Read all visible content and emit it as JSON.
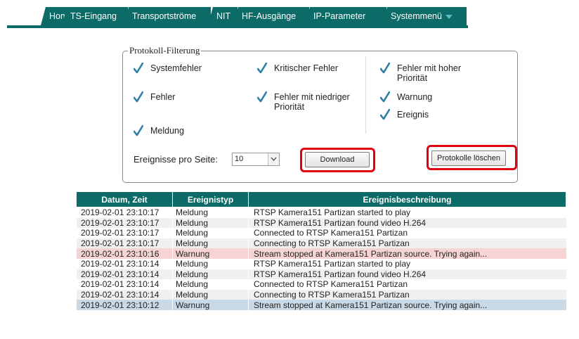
{
  "tabs": [
    {
      "label": "Home"
    },
    {
      "label": "TS-Eingang"
    },
    {
      "label": "Transportströme"
    },
    {
      "label": "NIT"
    },
    {
      "label": "HF-Ausgänge"
    },
    {
      "label": "IP-Parameter"
    },
    {
      "label": "Systemmenü"
    }
  ],
  "filter": {
    "legend": "Protokoll-Filterung",
    "checkboxes": [
      {
        "label": "Systemfehler",
        "checked": true
      },
      {
        "label": "Kritischer Fehler",
        "checked": true
      },
      {
        "label": "Fehler mit hoher\nPriorität",
        "checked": true
      },
      {
        "label": "Fehler",
        "checked": true
      },
      {
        "label": "Fehler mit niedriger\nPriorität",
        "checked": true
      },
      {
        "label": "Warnung",
        "checked": true
      },
      {
        "label": "Ereignis",
        "checked": true
      },
      {
        "label": "Meldung",
        "checked": true
      }
    ],
    "events_per_page_label": "Ereignisse pro Seite:",
    "events_per_page_value": "10",
    "download_label": "Download",
    "clear_label": "Protokolle löschen"
  },
  "colors": {
    "accent": "#0d6b67",
    "highlight": "#e0000f",
    "check": "#2d7fa6",
    "warn_row": "#f7d4d4",
    "selected_row": "#c9d9e5"
  },
  "table": {
    "headers": [
      "Datum, Zeit",
      "Ereignistyp",
      "Ereignisbeschreibung"
    ],
    "rows": [
      {
        "time": "2019-02-01 23:10:17",
        "type": "Meldung",
        "desc": "RTSP Kamera151 Partizan started to play"
      },
      {
        "time": "2019-02-01 23:10:17",
        "type": "Meldung",
        "desc": "RTSP Kamera151 Partizan found video H.264"
      },
      {
        "time": "2019-02-01 23:10:17",
        "type": "Meldung",
        "desc": "Connected to RTSP Kamera151 Partizan"
      },
      {
        "time": "2019-02-01 23:10:17",
        "type": "Meldung",
        "desc": "Connecting to RTSP Kamera151 Partizan"
      },
      {
        "time": "2019-02-01 23:10:16",
        "type": "Warnung",
        "desc": "Stream stopped at Kamera151 Partizan source. Trying again..."
      },
      {
        "time": "2019-02-01 23:10:14",
        "type": "Meldung",
        "desc": "RTSP Kamera151 Partizan started to play"
      },
      {
        "time": "2019-02-01 23:10:14",
        "type": "Meldung",
        "desc": "RTSP Kamera151 Partizan found video H.264"
      },
      {
        "time": "2019-02-01 23:10:14",
        "type": "Meldung",
        "desc": "Connected to RTSP Kamera151 Partizan"
      },
      {
        "time": "2019-02-01 23:10:14",
        "type": "Meldung",
        "desc": "Connecting to RTSP Kamera151 Partizan"
      },
      {
        "time": "2019-02-01 23:10:12",
        "type": "Warnung",
        "desc": "Stream stopped at Kamera151 Partizan source. Trying again..."
      }
    ]
  }
}
